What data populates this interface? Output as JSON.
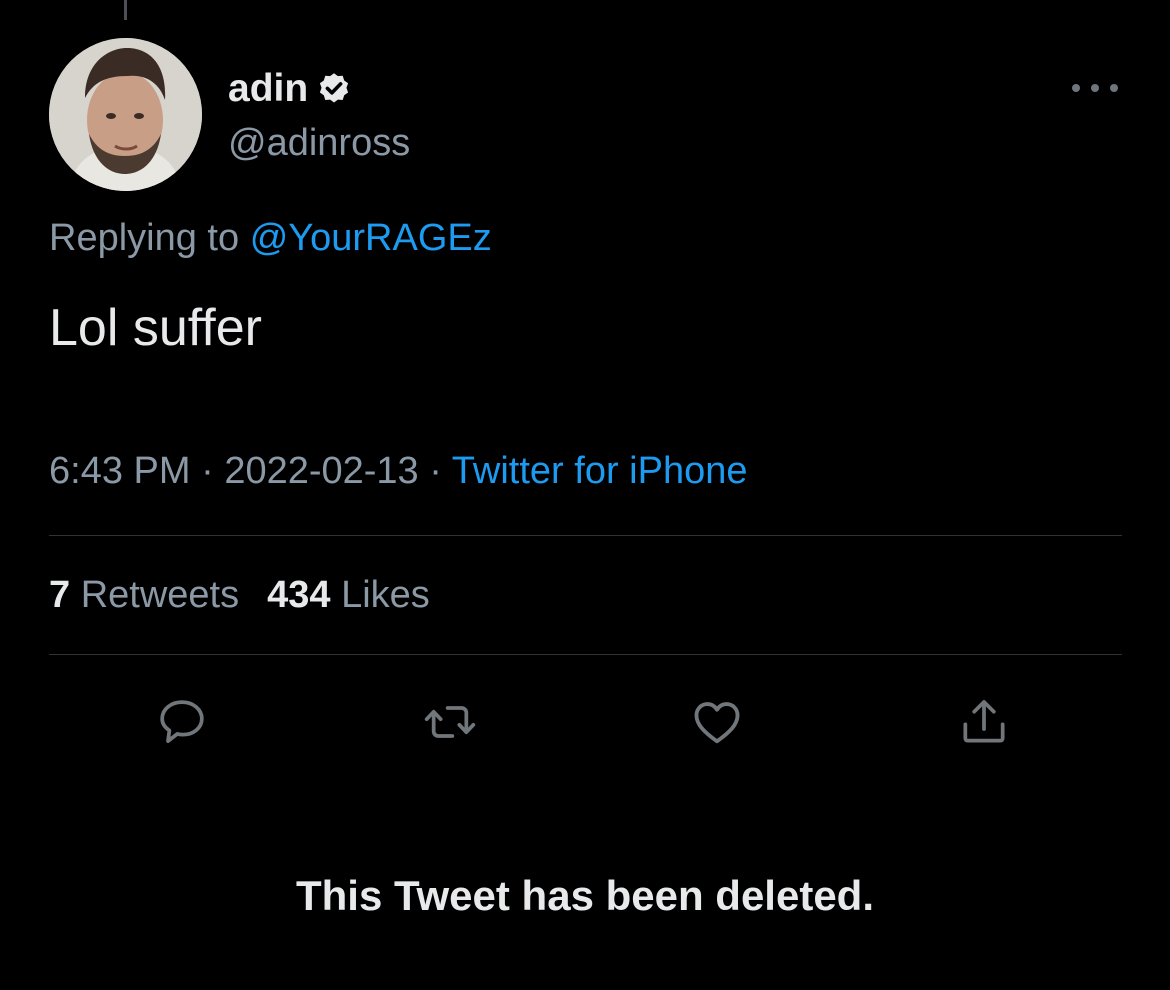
{
  "author": {
    "display_name": "adin",
    "handle": "@adinross",
    "verified": true,
    "avatar_icon": "profile-photo"
  },
  "reply_context": {
    "prefix": "Replying to",
    "mention": "@YourRAGEz"
  },
  "tweet": {
    "text": "Lol suffer",
    "time": "6:43 PM",
    "separator": "·",
    "date": "2022-02-13",
    "source": "Twitter for iPhone"
  },
  "stats": {
    "retweets_count": "7",
    "retweets_label": "Retweets",
    "likes_count": "434",
    "likes_label": "Likes"
  },
  "actions": {
    "reply_icon": "speech-bubble-icon",
    "retweet_icon": "retweet-arrows-icon",
    "like_icon": "heart-icon",
    "share_icon": "share-upload-icon"
  },
  "notice": {
    "deleted_text": "This Tweet has been deleted."
  },
  "colors": {
    "background": "#000000",
    "primary_text": "#e7e9ea",
    "secondary_text": "#8b98a5",
    "accent": "#1d9bf0",
    "divider": "#2f3336"
  }
}
